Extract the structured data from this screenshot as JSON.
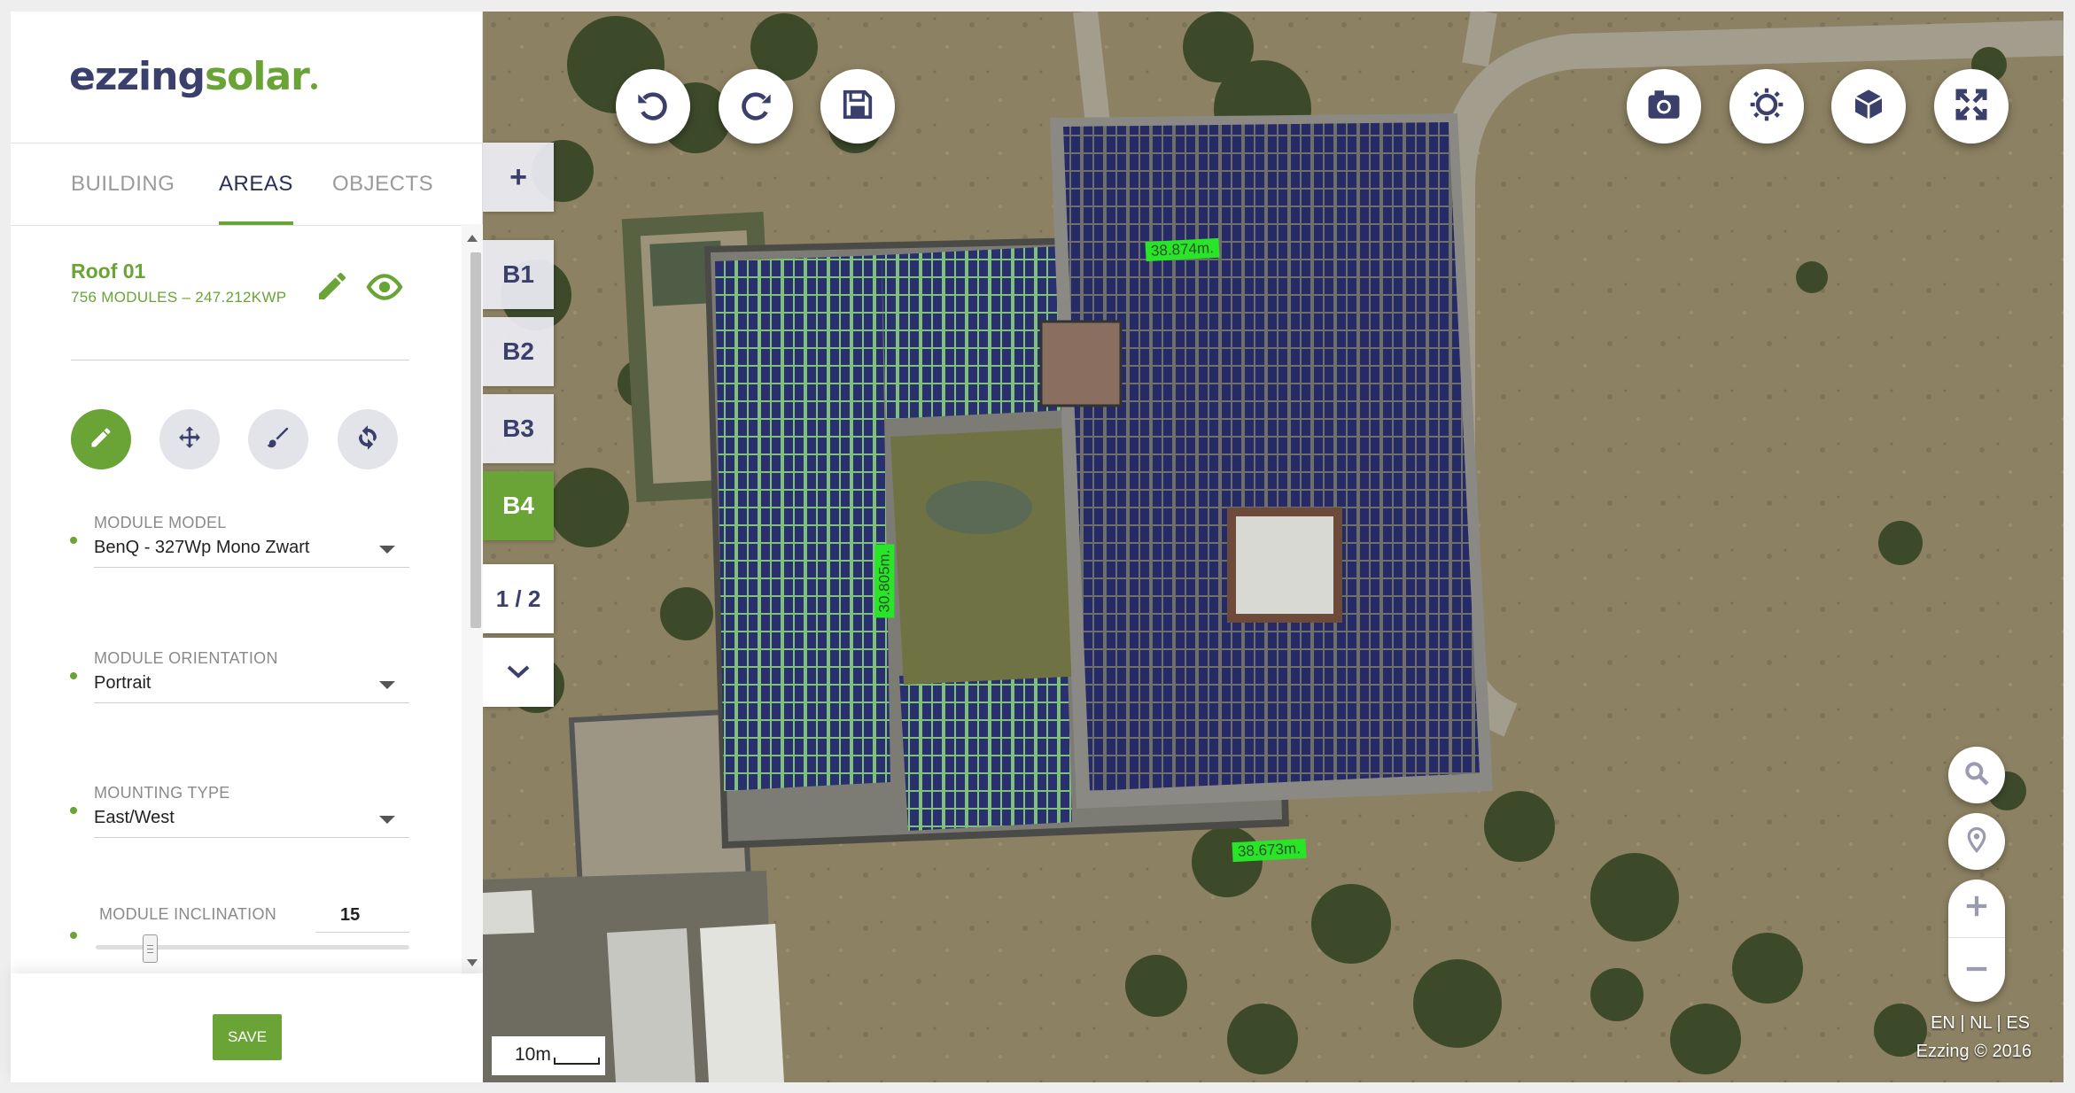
{
  "logo": {
    "part1": "ezzing",
    "part2": "solar"
  },
  "tabs": {
    "building": "BUILDING",
    "areas": "AREAS",
    "objects": "OBJECTS",
    "active": "AREAS"
  },
  "roof": {
    "title": "Roof 01",
    "subtitle": "756 MODULES – 247.212KWP"
  },
  "tools": [
    "pencil-icon",
    "move-icon",
    "brush-icon",
    "refresh-icon"
  ],
  "fields": {
    "module_model": {
      "label": "MODULE MODEL",
      "value": "BenQ - 327Wp Mono Zwart"
    },
    "module_orientation": {
      "label": "MODULE ORIENTATION",
      "value": "Portrait"
    },
    "mounting_type": {
      "label": "MOUNTING TYPE",
      "value": "East/West"
    },
    "module_inclination": {
      "label": "MODULE INCLINATION",
      "value": "15"
    }
  },
  "save_label": "SAVE",
  "map": {
    "add_label": "+",
    "buildings": [
      "B1",
      "B2",
      "B3",
      "B4"
    ],
    "active_building": "B4",
    "pagination": "1 / 2",
    "measurements": {
      "top": "38.874m.",
      "left": "30.805m.",
      "bottom": "38.673m."
    },
    "scale_label": "10m",
    "languages": [
      "EN",
      "NL",
      "ES"
    ],
    "copyright": "Ezzing © 2016"
  },
  "colors": {
    "accent_green": "#6aa336",
    "brand_navy": "#3a3f6b",
    "measure_green": "#28e528"
  }
}
